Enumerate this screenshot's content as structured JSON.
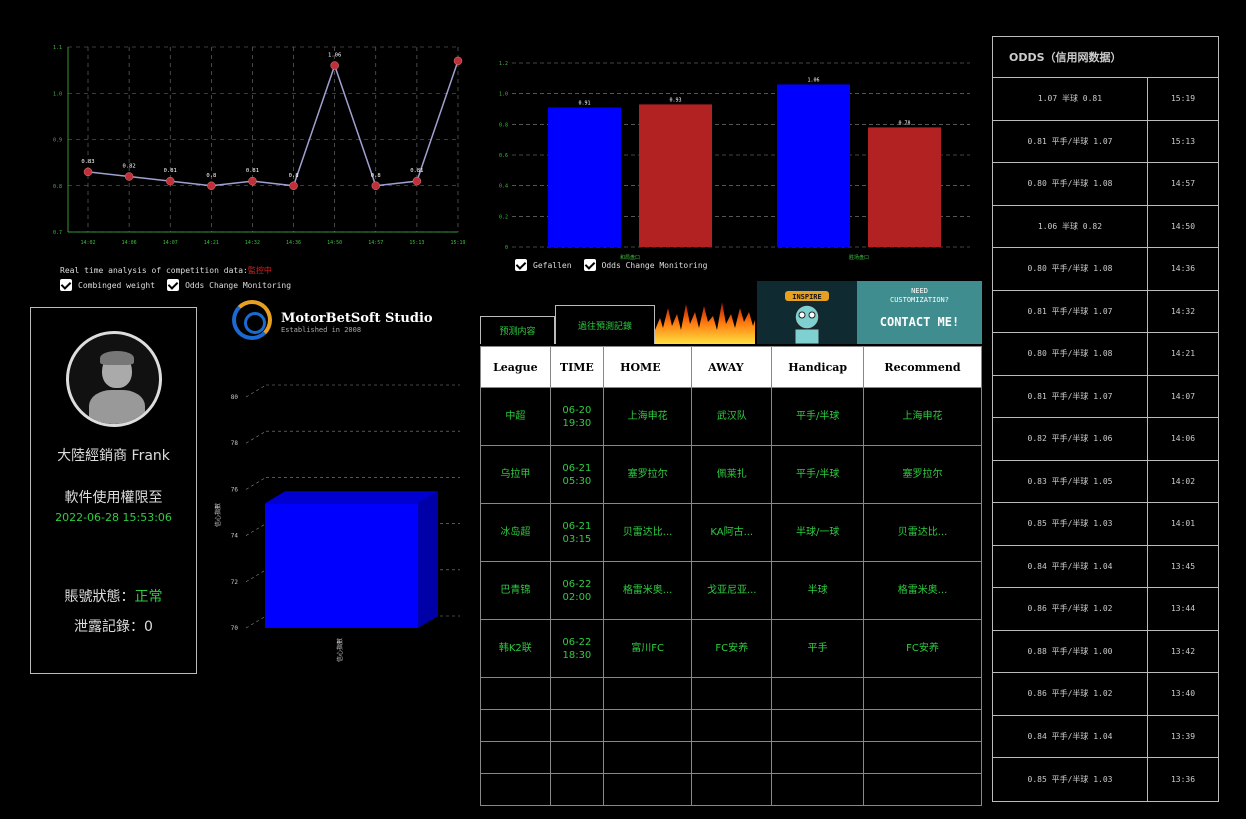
{
  "line_chart_caption": {
    "prefix": "Real time analysis of competition data:",
    "status": "監控中"
  },
  "line_legend": {
    "item1": "Combinged weight",
    "item2": "Odds Change Monitoring"
  },
  "bar_legend": {
    "item1": "Gefallen",
    "item2": "Odds Change Monitoring"
  },
  "chart_data": [
    {
      "type": "line",
      "x": [
        "14:02",
        "14:06",
        "14:07",
        "14:21",
        "14:32",
        "14:36",
        "14:50",
        "14:57",
        "15:13",
        "15:19"
      ],
      "values": [
        0.83,
        0.82,
        0.81,
        0.8,
        0.81,
        0.8,
        1.06,
        0.8,
        0.81,
        1.07
      ],
      "data_labels": [
        "0.83",
        "0.82",
        "0.81",
        "0.8",
        "0.81",
        "0.8",
        "1.06",
        "0.8",
        "0.81",
        ""
      ],
      "y_ticks": [
        "0.7",
        "0.8",
        "0.9",
        "1.0",
        "1.1"
      ],
      "ylim": [
        0.7,
        1.1
      ],
      "line_color": "#a0a0d0",
      "point_color": "#c0303a",
      "grid": true
    },
    {
      "type": "bar",
      "categories": [
        "和局盘口",
        "胜场盘口"
      ],
      "series": [
        {
          "values": [
            0.91,
            1.06
          ],
          "color": "#0000ff"
        },
        {
          "values": [
            0.93,
            0.78
          ],
          "color": "#b22222"
        }
      ],
      "data_labels": [
        [
          "0.91",
          "1.06"
        ],
        [
          "0.93",
          "0.78"
        ]
      ],
      "y_ticks": [
        "0",
        "0.2",
        "0.4",
        "0.6",
        "0.8",
        "1.0",
        "1.2"
      ],
      "ylim": [
        0,
        1.2
      ],
      "grid": true
    },
    {
      "type": "bar",
      "categories": [
        "信心指數"
      ],
      "values": [
        75.4
      ],
      "ylabel": "信心指數",
      "y_ticks": [
        "70",
        "72",
        "74",
        "76",
        "78",
        "80"
      ],
      "ylim": [
        70,
        80
      ],
      "color": "#0000ff"
    }
  ],
  "profile": {
    "name": "大陸經銷商 Frank",
    "license_label": "軟件使用權限至",
    "license_date": "2022-06-28 15:53:06",
    "status_label": "賬號狀態：",
    "status_value": "正常",
    "leak_label": "泄露記錄：0"
  },
  "logo": {
    "name": "MotorBetSoft Studio",
    "sub": "Established in 2008"
  },
  "tabs": {
    "predict": "预测内容",
    "history": "過往預測記錄"
  },
  "ads": {
    "inspire": "INSPIRE",
    "need": "NEED",
    "custom": "CUSTOMIZATION?",
    "contact": "CONTACT ME!"
  },
  "table": {
    "headers": [
      "League",
      "TIME",
      "HOME",
      "AWAY",
      "Handicap",
      "Recommend"
    ],
    "rows": [
      [
        "中超",
        "06-20",
        "19:30",
        "上海申花",
        "武汉队",
        "平手/半球",
        "上海申花"
      ],
      [
        "乌拉甲",
        "06-21",
        "05:30",
        "塞罗拉尔",
        "佩莱扎",
        "平手/半球",
        "塞罗拉尔"
      ],
      [
        "冰岛超",
        "06-21",
        "03:15",
        "贝雷达比...",
        "KA阿古...",
        "半球/一球",
        "贝雷达比..."
      ],
      [
        "巴青锦",
        "06-22",
        "02:00",
        "格雷米奥...",
        "戈亚尼亚...",
        "半球",
        "格雷米奥..."
      ],
      [
        "韩K2联",
        "06-22",
        "18:30",
        "富川FC",
        "FC安养",
        "平手",
        "FC安养"
      ]
    ]
  },
  "odds": {
    "title": "ODDS（信用网数据）",
    "rows": [
      [
        "1.07 半球 0.81",
        "15:19"
      ],
      [
        "0.81 平手/半球 1.07",
        "15:13"
      ],
      [
        "0.80 平手/半球 1.08",
        "14:57"
      ],
      [
        "1.06 半球 0.82",
        "14:50"
      ],
      [
        "0.80 平手/半球 1.08",
        "14:36"
      ],
      [
        "0.81 平手/半球 1.07",
        "14:32"
      ],
      [
        "0.80 平手/半球 1.08",
        "14:21"
      ],
      [
        "0.81 平手/半球 1.07",
        "14:07"
      ],
      [
        "0.82 平手/半球 1.06",
        "14:06"
      ],
      [
        "0.83 平手/半球 1.05",
        "14:02"
      ],
      [
        "0.85 平手/半球 1.03",
        "14:01"
      ],
      [
        "0.84 平手/半球 1.04",
        "13:45"
      ],
      [
        "0.86 平手/半球 1.02",
        "13:44"
      ],
      [
        "0.88 平手/半球 1.00",
        "13:42"
      ],
      [
        "0.86 平手/半球 1.02",
        "13:40"
      ],
      [
        "0.84 平手/半球 1.04",
        "13:39"
      ],
      [
        "0.85 平手/半球 1.03",
        "13:36"
      ]
    ]
  }
}
